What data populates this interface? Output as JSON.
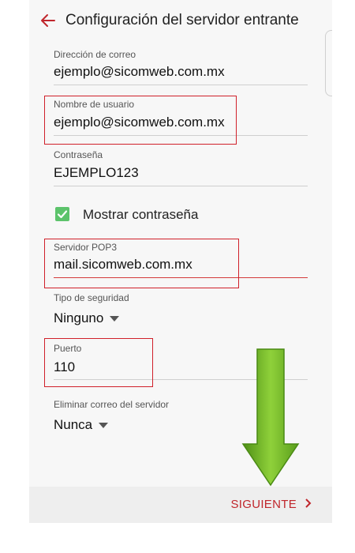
{
  "header": {
    "title": "Configuración del servidor entrante"
  },
  "fields": {
    "email": {
      "label": "Dirección de correo",
      "value": "ejemplo@sicomweb.com.mx"
    },
    "username": {
      "label": "Nombre de usuario",
      "value": "ejemplo@sicomweb.com.mx"
    },
    "password": {
      "label": "Contraseña",
      "value": "EJEMPLO123"
    },
    "show_password": {
      "label": "Mostrar contraseña",
      "checked": true
    },
    "server": {
      "label": "Servidor POP3",
      "value": "mail.sicomweb.com.mx"
    },
    "security": {
      "label": "Tipo de seguridad",
      "value": "Ninguno"
    },
    "port": {
      "label": "Puerto",
      "value": "110"
    },
    "delete": {
      "label": "Eliminar correo del servidor",
      "value": "Nunca"
    }
  },
  "footer": {
    "next_label": "SIGUIENTE"
  },
  "colors": {
    "accent": "#c0262c",
    "checkbox": "#5cc36b",
    "arrow": "#6ab023"
  }
}
